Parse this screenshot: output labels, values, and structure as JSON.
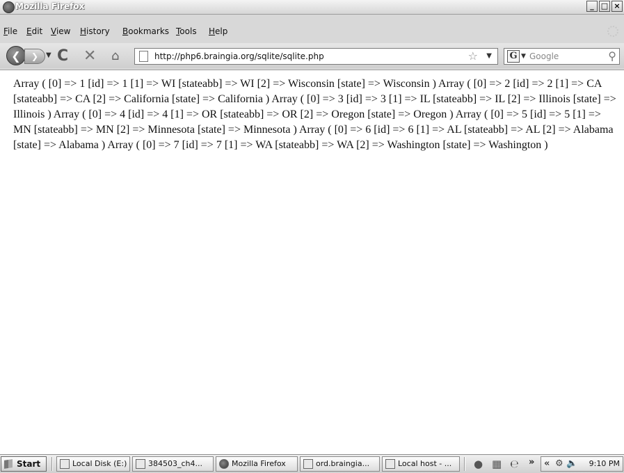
{
  "window": {
    "title": "Mozilla Firefox",
    "controls": {
      "minimize": "_",
      "maximize": "□",
      "close": "×"
    }
  },
  "menu": {
    "items": [
      {
        "label": "File"
      },
      {
        "label": "Edit"
      },
      {
        "label": "View"
      },
      {
        "label": "History"
      },
      {
        "label": "Bookmarks"
      },
      {
        "label": "Tools"
      },
      {
        "label": "Help"
      }
    ]
  },
  "toolbar": {
    "url": "http://php6.braingia.org/sqlite/sqlite.php",
    "search_placeholder": "Google",
    "search_engine_letter": "G"
  },
  "content": {
    "text": "Array ( [0] => 1 [id] => 1 [1] => WI [stateabb] => WI [2] => Wisconsin [state] => Wisconsin ) Array ( [0] => 2 [id] => 2 [1] => CA [stateabb] => CA [2] => California [state] => California ) Array ( [0] => 3 [id] => 3 [1] => IL [stateabb] => IL [2] => Illinois [state] => Illinois ) Array ( [0] => 4 [id] => 4 [1] => OR [stateabb] => OR [2] => Oregon [state] => Oregon ) Array ( [0] => 5 [id] => 5 [1] => MN [stateabb] => MN [2] => Minnesota [state] => Minnesota ) Array ( [0] => 6 [id] => 6 [1] => AL [stateabb] => AL [2] => Alabama [state] => Alabama ) Array ( [0] => 7 [id] => 7 [1] => WA [stateabb] => WA [2] => Washington [state] => Washington )"
  },
  "taskbar": {
    "start_label": "Start",
    "tasks": [
      {
        "label": "Local Disk (E:)"
      },
      {
        "label": "384503_ch4..."
      },
      {
        "label": "Mozilla Firefox"
      },
      {
        "label": "ord.braingia..."
      },
      {
        "label": "Local host - ..."
      }
    ],
    "overflow": "»",
    "tray_collapse": "«",
    "clock": "9:10 PM"
  }
}
